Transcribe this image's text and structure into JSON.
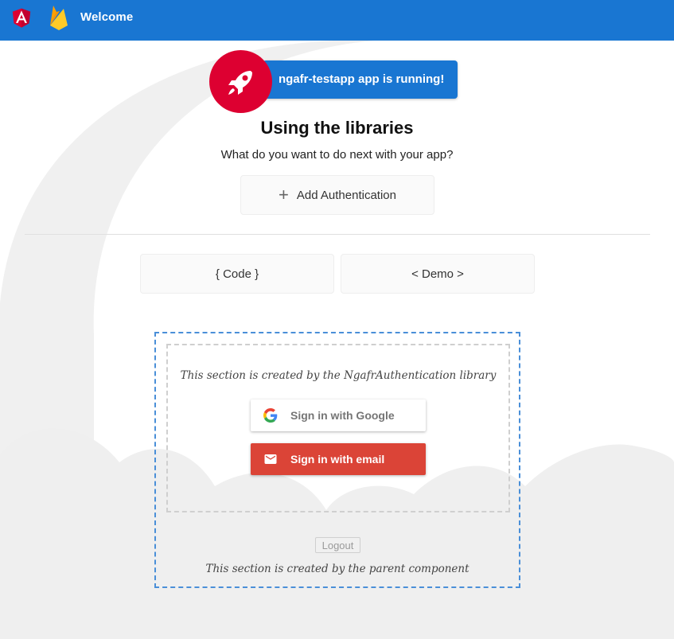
{
  "toolbar": {
    "title": "Welcome",
    "background": "#1976d2"
  },
  "banner": {
    "text": "ngafr-testapp app is running!",
    "icon": "rocket-icon",
    "accent": "#dd0031"
  },
  "main": {
    "title": "Using the libraries",
    "subtitle": "What do you want to do next with your app?",
    "add_auth_label": "Add Authentication",
    "code_label": "{ Code }",
    "demo_label": "< Demo >"
  },
  "library_section": {
    "text": "This section is created by the NgafrAuthentication library",
    "google_label": "Sign in with Google",
    "email_label": "Sign in with email"
  },
  "parent_section": {
    "logout_label": "Logout",
    "text": "This section is created by the parent component"
  }
}
